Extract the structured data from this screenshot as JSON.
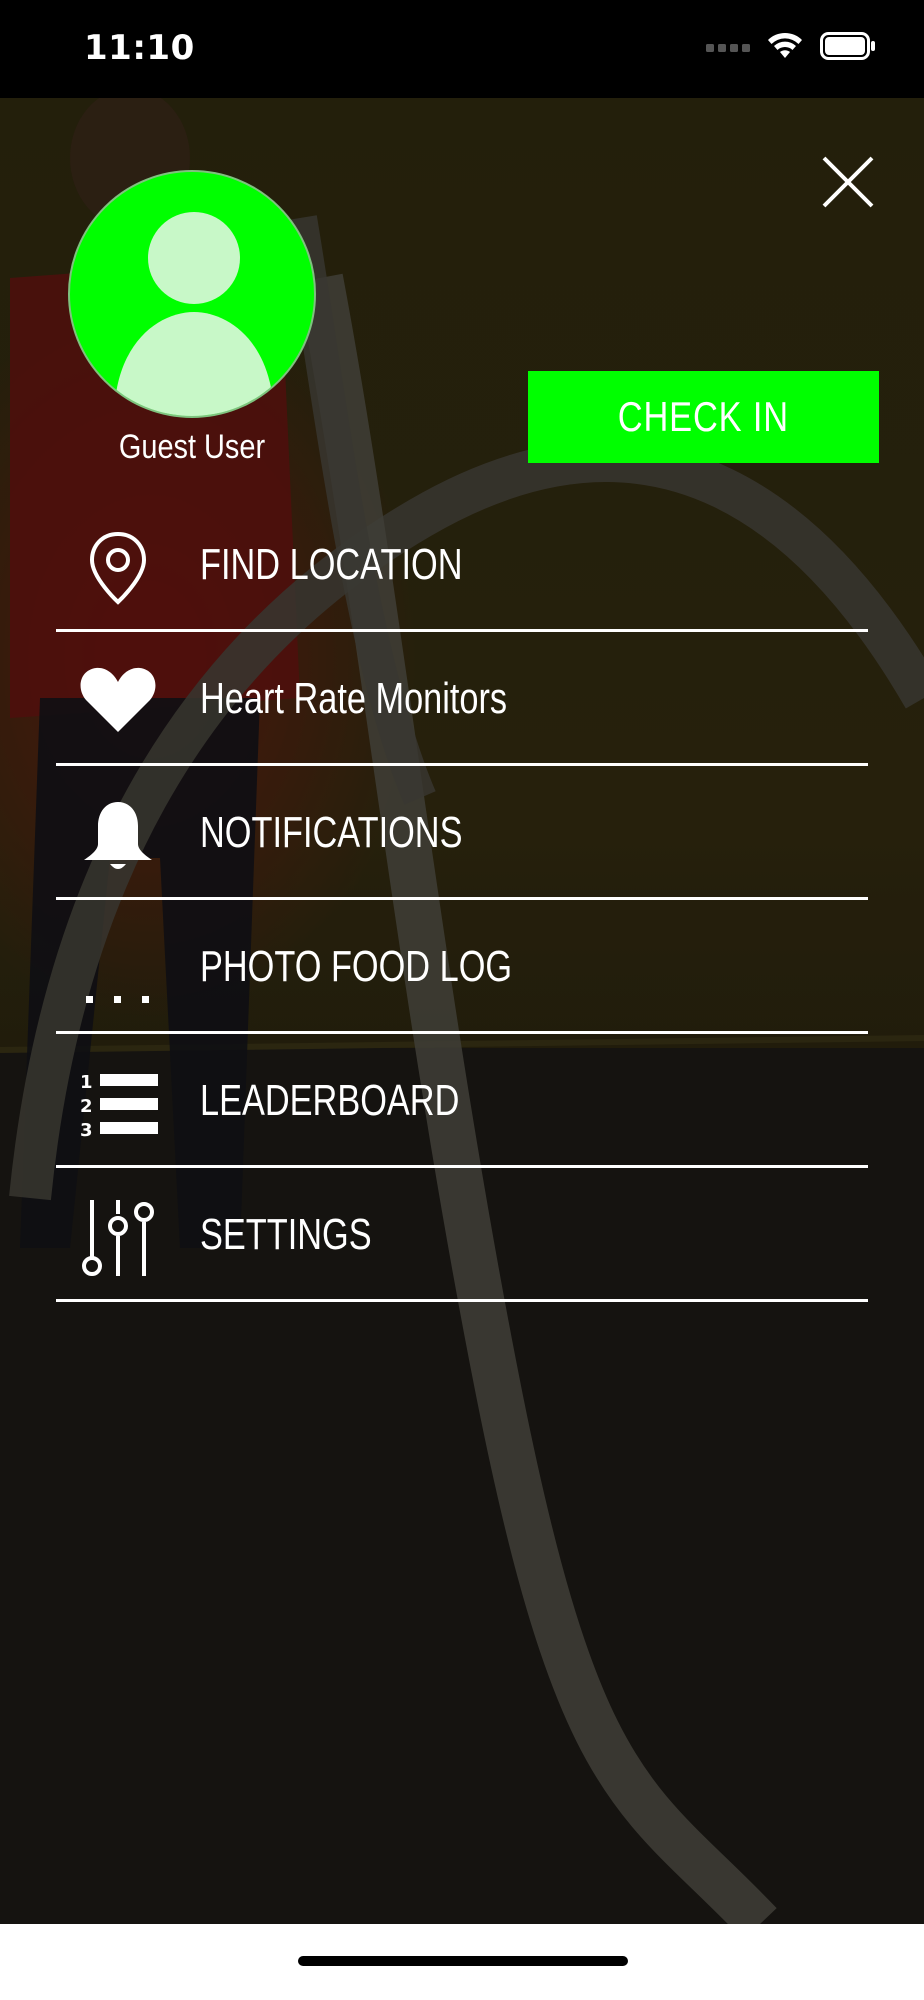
{
  "status_bar": {
    "time": "11:10"
  },
  "profile": {
    "name": "Guest User"
  },
  "actions": {
    "check_in_label": "CHECK IN"
  },
  "menu": {
    "items": [
      {
        "label": "FIND LOCATION",
        "icon": "location-pin-icon"
      },
      {
        "label": "Heart Rate Monitors",
        "icon": "heart-icon"
      },
      {
        "label": "NOTIFICATIONS",
        "icon": "bell-icon"
      },
      {
        "label": "PHOTO FOOD LOG",
        "icon": "more-dots-icon"
      },
      {
        "label": "LEADERBOARD",
        "icon": "ranked-list-icon"
      },
      {
        "label": "SETTINGS",
        "icon": "sliders-icon"
      }
    ]
  },
  "colors": {
    "accent": "#00ff00",
    "text": "#ffffff",
    "divider": "#ffffff"
  }
}
